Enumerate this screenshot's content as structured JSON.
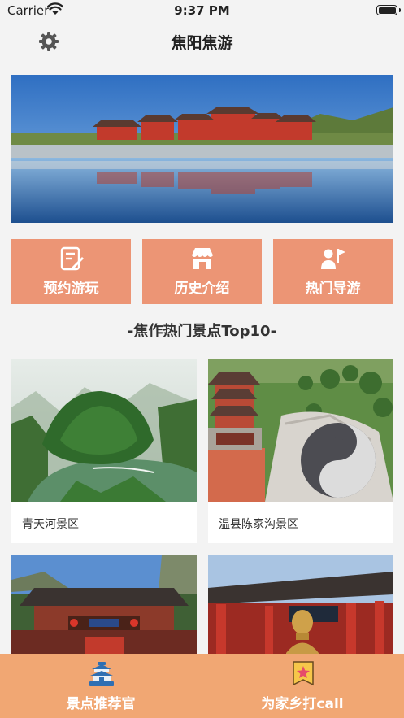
{
  "status_bar": {
    "carrier": "Carrier",
    "time": "9:37 PM"
  },
  "nav": {
    "title": "焦阳焦游",
    "settings_icon": "gear-icon"
  },
  "banner": {
    "alt_icon": "palace-lake-photo"
  },
  "actions": [
    {
      "label": "预约游玩",
      "icon": "edit-note-icon"
    },
    {
      "label": "历史介绍",
      "icon": "storefront-icon"
    },
    {
      "label": "热门导游",
      "icon": "guide-flag-icon"
    }
  ],
  "section": {
    "title": "-焦作热门景点Top10-"
  },
  "spots": [
    {
      "name": "青天河景区"
    },
    {
      "name": "温县陈家沟景区"
    },
    {
      "name": ""
    },
    {
      "name": ""
    }
  ],
  "tabs": [
    {
      "label": "景点推荐官",
      "icon": "temple-icon"
    },
    {
      "label": "为家乡打call",
      "icon": "star-badge-icon"
    }
  ],
  "colors": {
    "accent": "#ec9575",
    "tab_bar": "#f1a773",
    "background": "#f3f3f3"
  }
}
